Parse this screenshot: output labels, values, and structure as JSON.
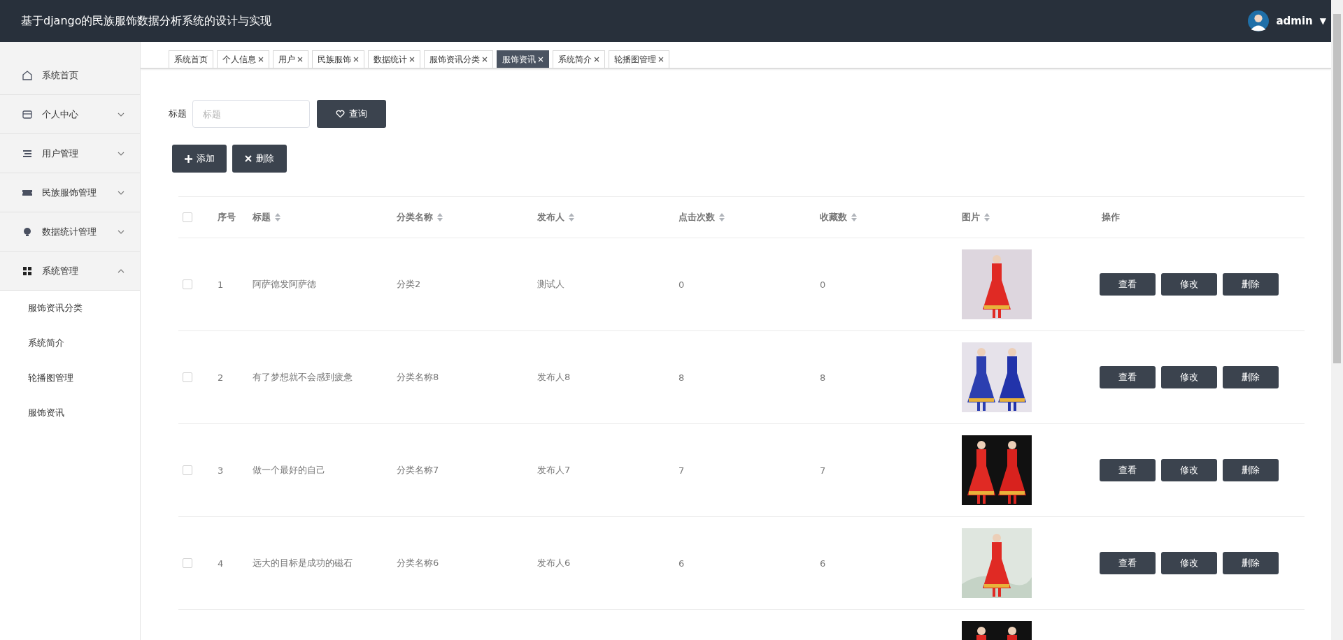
{
  "header": {
    "title": "基于django的民族服饰数据分析系统的设计与实现",
    "user": "admin",
    "caret": "▼"
  },
  "sidebar": {
    "items": [
      {
        "label": "系统首页"
      },
      {
        "label": "个人中心",
        "expanded": false
      },
      {
        "label": "用户管理",
        "expanded": false
      },
      {
        "label": "民族服饰管理",
        "expanded": false
      },
      {
        "label": "数据统计管理",
        "expanded": false
      },
      {
        "label": "系统管理",
        "expanded": true,
        "children": [
          {
            "label": "服饰资讯分类"
          },
          {
            "label": "系统简介"
          },
          {
            "label": "轮播图管理"
          },
          {
            "label": "服饰资讯"
          }
        ]
      }
    ]
  },
  "tabs": [
    {
      "label": "系统首页",
      "closable": false,
      "selected": false
    },
    {
      "label": "个人信息",
      "closable": true,
      "selected": false
    },
    {
      "label": "用户",
      "closable": true,
      "selected": false
    },
    {
      "label": "民族服饰",
      "closable": true,
      "selected": false
    },
    {
      "label": "数据统计",
      "closable": true,
      "selected": false
    },
    {
      "label": "服饰资讯分类",
      "closable": true,
      "selected": false
    },
    {
      "label": "服饰资讯",
      "closable": true,
      "selected": true
    },
    {
      "label": "系统简介",
      "closable": true,
      "selected": false
    },
    {
      "label": "轮播图管理",
      "closable": true,
      "selected": false
    }
  ],
  "search": {
    "label": "标题",
    "placeholder": "标题",
    "button": "查询"
  },
  "toolbar": {
    "add": "添加",
    "delete": "删除"
  },
  "table": {
    "columns": [
      {
        "label": "序号",
        "sortable": false
      },
      {
        "label": "标题",
        "sortable": true
      },
      {
        "label": "分类名称",
        "sortable": true
      },
      {
        "label": "发布人",
        "sortable": true
      },
      {
        "label": "点击次数",
        "sortable": true
      },
      {
        "label": "收藏数",
        "sortable": true
      },
      {
        "label": "图片",
        "sortable": true
      },
      {
        "label": "操作",
        "sortable": false
      }
    ],
    "header_checked": false,
    "rows": [
      {
        "checked": false,
        "cells": [
          "1",
          "阿萨德发阿萨德",
          "分类2",
          "测试人",
          "0",
          "0"
        ],
        "picture": {
          "kind": "picture"
        },
        "actions": [
          "查看",
          "修改",
          "删除"
        ]
      },
      {
        "checked": false,
        "cells": [
          "2",
          "有了梦想就不会感到疲惫",
          "分类名称8",
          "发布人8",
          "8",
          "8"
        ],
        "picture": {
          "kind": "picture"
        },
        "actions": [
          "查看",
          "修改",
          "删除"
        ]
      },
      {
        "checked": false,
        "cells": [
          "3",
          "做一个最好的自己",
          "分类名称7",
          "发布人7",
          "7",
          "7"
        ],
        "picture": {
          "kind": "picture"
        },
        "actions": [
          "查看",
          "修改",
          "删除"
        ]
      },
      {
        "checked": false,
        "cells": [
          "4",
          "远大的目标是成功的磁石",
          "分类名称6",
          "发布人6",
          "6",
          "6"
        ],
        "picture": {
          "kind": "picture"
        },
        "actions": [
          "查看",
          "修改",
          "删除"
        ]
      },
      {
        "picture": {
          "kind": "picture"
        }
      }
    ]
  }
}
